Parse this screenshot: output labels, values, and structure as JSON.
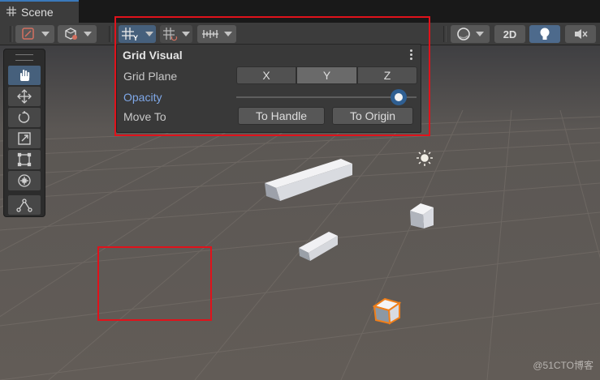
{
  "tab": {
    "title": "Scene",
    "icon": "grid-icon"
  },
  "toolbar": {
    "view2d_label": "2D",
    "buttons": [
      "gizmo-dropdown",
      "draw-mode-dropdown",
      "grid-visual-button",
      "grid-snap-button",
      "increment-snap-button",
      "render-mode-button",
      "2d-toggle",
      "lighting-toggle",
      "audio-toggle"
    ]
  },
  "tools": [
    "hand-tool",
    "move-tool",
    "rotate-tool",
    "scale-tool",
    "rect-tool",
    "transform-tool",
    "custom-tool"
  ],
  "grid_visual": {
    "title": "Grid Visual",
    "grid_plane_label": "Grid Plane",
    "planes": [
      "X",
      "Y",
      "Z"
    ],
    "selected_plane": "Y",
    "opacity_label": "Opacity",
    "opacity_value": 0.9,
    "move_to_label": "Move To",
    "to_handle_label": "To Handle",
    "to_origin_label": "To Origin"
  },
  "watermark": "@51CTO博客",
  "colors": {
    "highlight_red": "#e0121b",
    "accent_blue": "#46607c",
    "opacity_label_blue": "#7fa8e8",
    "selection_orange": "#f07f1a"
  }
}
